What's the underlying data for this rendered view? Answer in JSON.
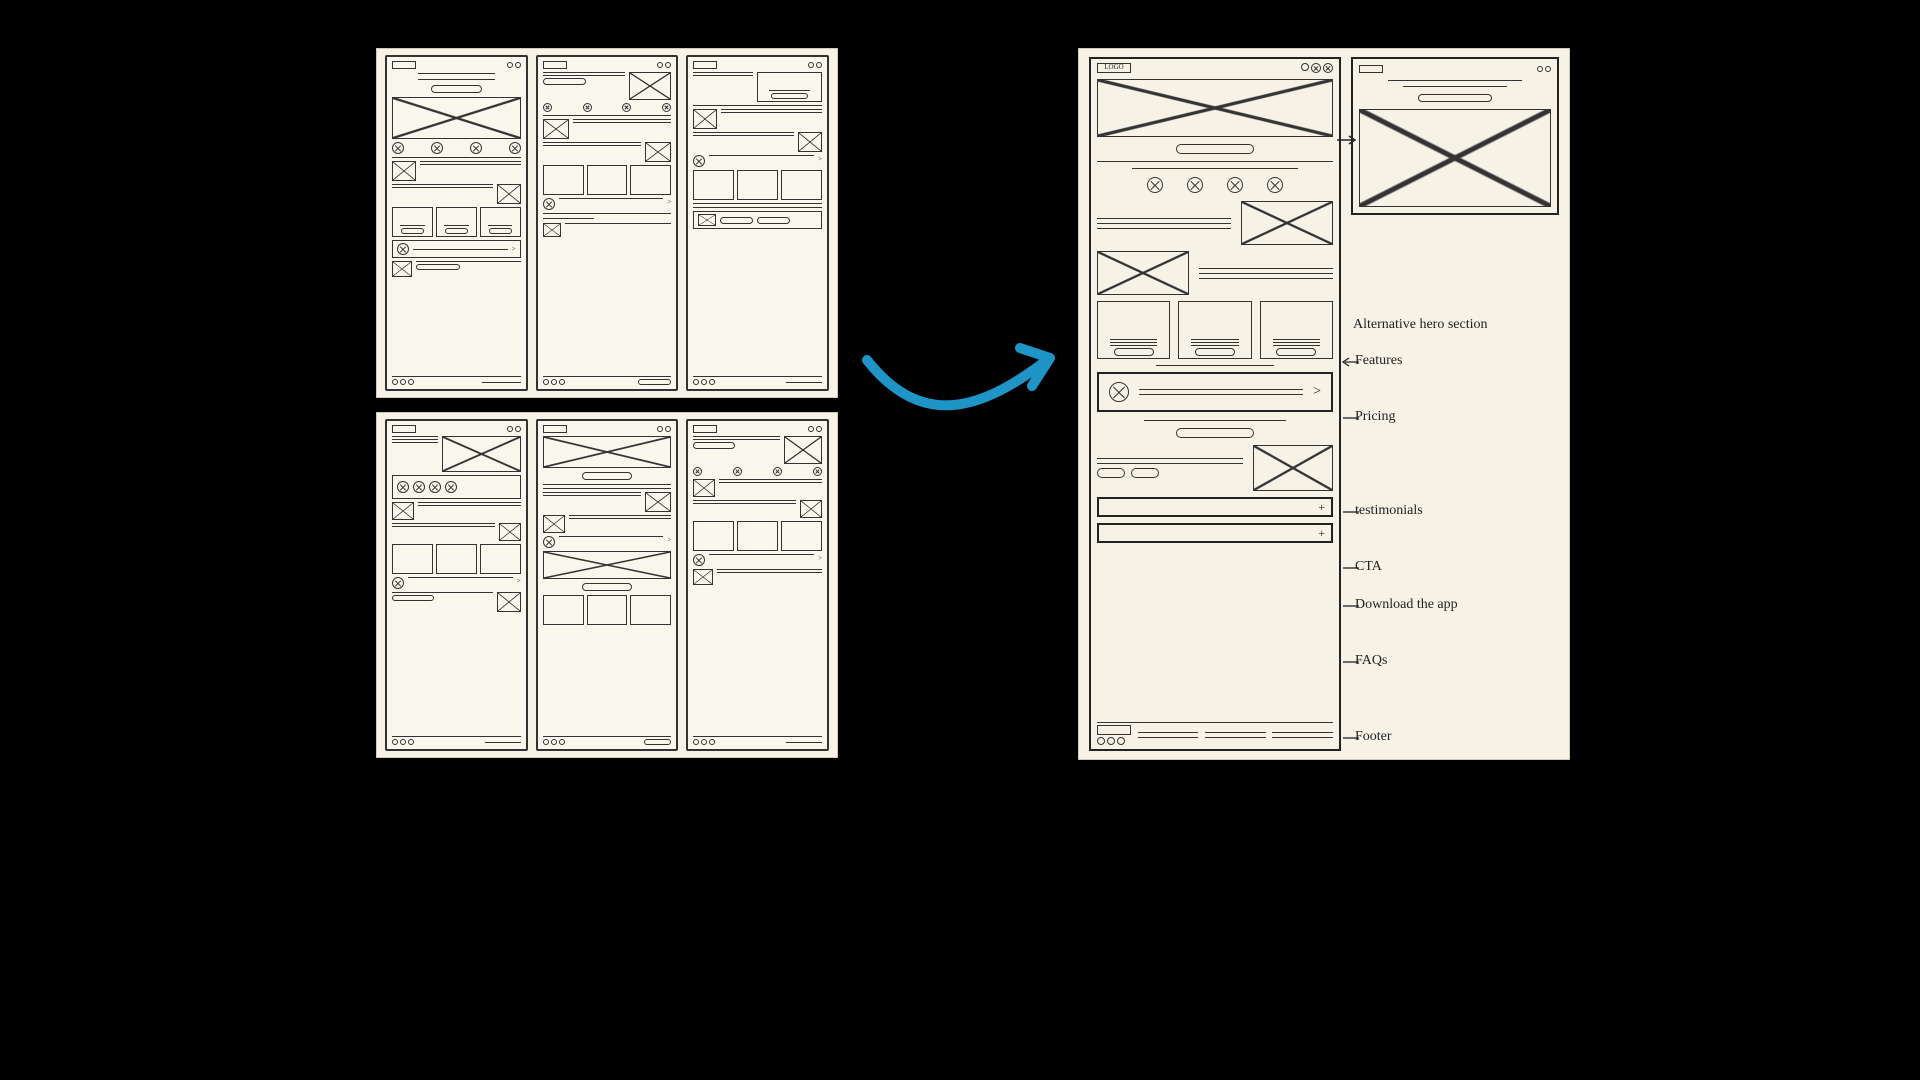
{
  "logo_text": "LOGO",
  "annotations": {
    "alt_hero": "Alternative hero section",
    "features": "Features",
    "pricing": "Pricing",
    "testimonials": "testimonials",
    "cta": "CTA",
    "download": "Download the app",
    "faqs": "FAQs",
    "footer": "Footer"
  },
  "faq_plus": "+",
  "testimonial_next": ">"
}
